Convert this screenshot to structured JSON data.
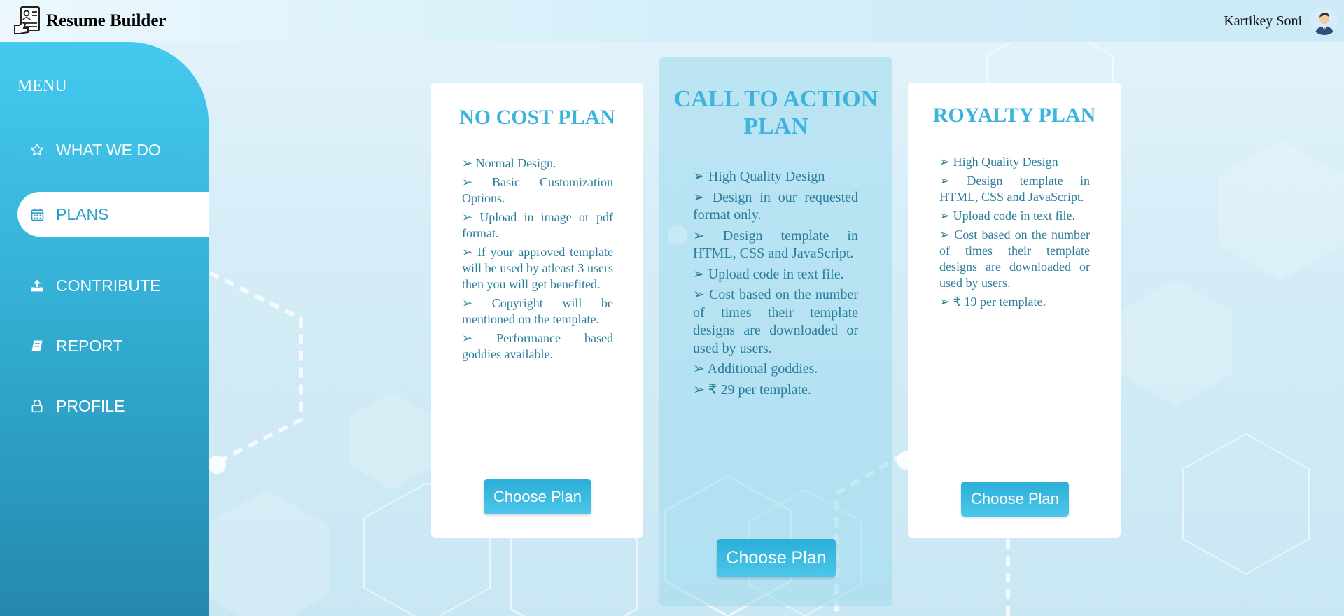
{
  "header": {
    "title": "Resume Builder",
    "user_name": "Kartikey Soni"
  },
  "sidebar": {
    "menu_title": "MENU",
    "items": [
      {
        "label": "WHAT WE DO",
        "icon": "star-icon"
      },
      {
        "label": "PLANS",
        "icon": "calendar-icon",
        "active": true
      },
      {
        "label": "CONTRIBUTE",
        "icon": "upload-icon"
      },
      {
        "label": "REPORT",
        "icon": "book-icon"
      },
      {
        "label": "PROFILE",
        "icon": "lock-icon"
      }
    ]
  },
  "plans": [
    {
      "title": "NO COST PLAN",
      "features": [
        "➢ Normal Design.",
        "➢ Basic Customization Options.",
        "➢ Upload in image or pdf format.",
        "➢ If your approved template will be used by atleast 3 users then you will get benefited.",
        "➢ Copyright will be mentioned on the template.",
        "➢ Performance based goddies available."
      ],
      "button": "Choose Plan"
    },
    {
      "title": "CALL TO ACTION PLAN",
      "features": [
        "➢ High Quality Design",
        "➢ Design in our requested format only.",
        "➢ Design template in HTML, CSS and JavaScript.",
        "➢ Upload code in text file.",
        "➢ Cost based on the number of times their template designs are downloaded or used by users.",
        "➢ Additional goddies.",
        "➢ ₹ 29 per template."
      ],
      "button": "Choose Plan"
    },
    {
      "title": "ROYALTY PLAN",
      "features": [
        "➢ High Quality Design",
        "➢ Design template in HTML, CSS and JavaScript.",
        "➢ Upload code in text file.",
        "➢ Cost based on the number of times their template designs are downloaded or used by users.",
        "➢ ₹ 19 per template."
      ],
      "button": "Choose Plan"
    }
  ],
  "colors": {
    "accent": "#3cb4dc",
    "sidebar_top": "#45c9ef",
    "sidebar_bottom": "#2588ac",
    "feature_text": "#2b7d9c"
  }
}
